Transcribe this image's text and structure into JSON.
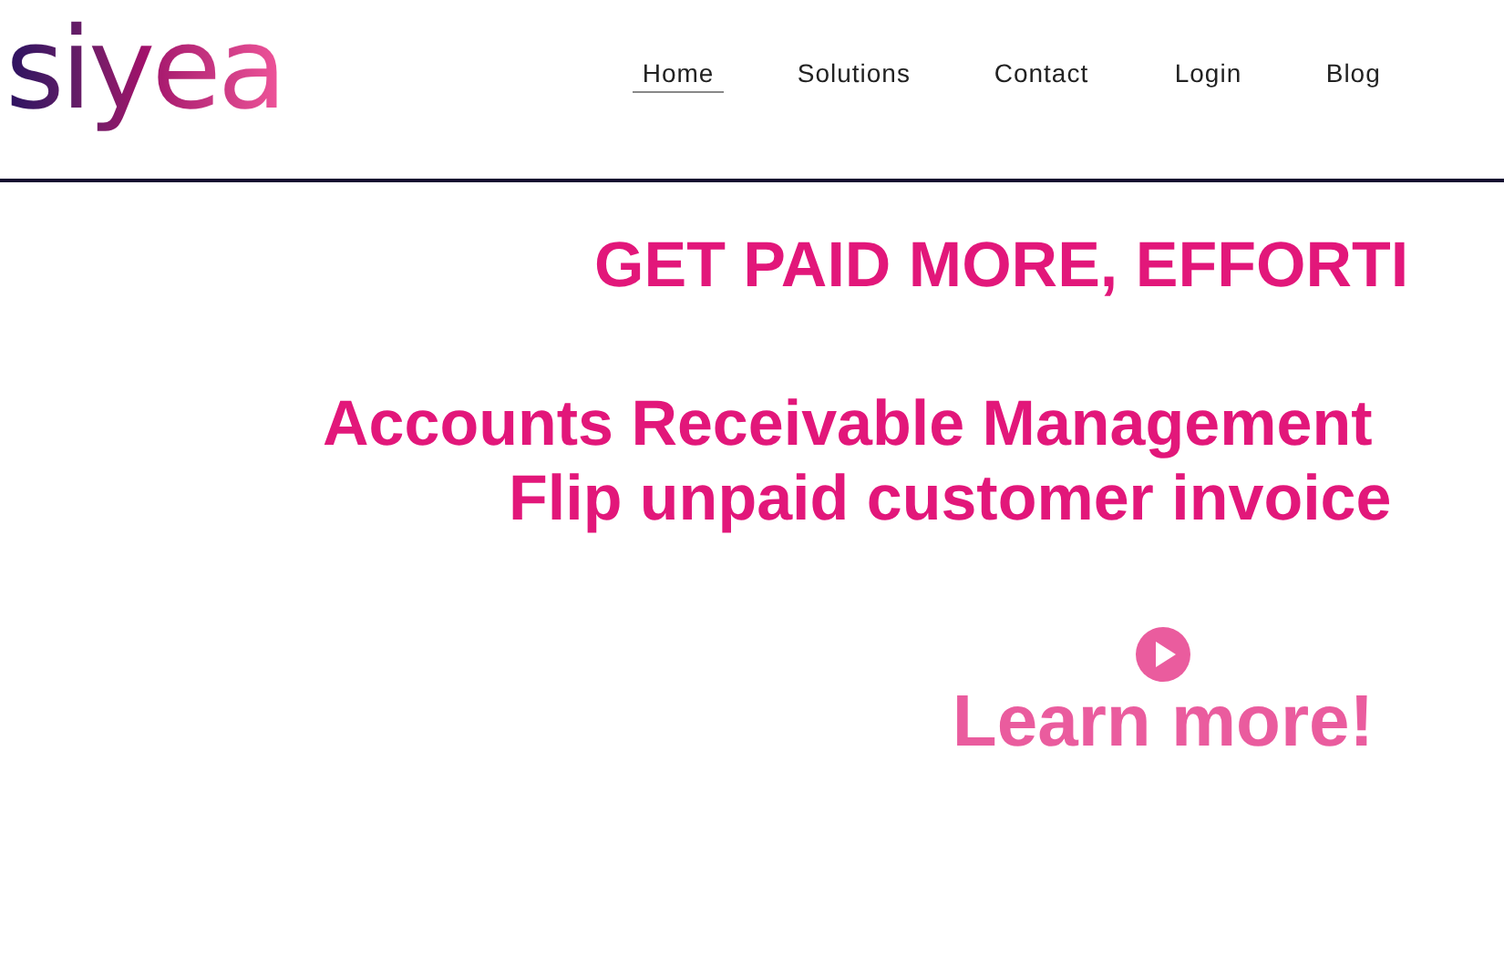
{
  "logo": "siyea",
  "nav": [
    {
      "label": "Home",
      "selected": true
    },
    {
      "label": "Solutions",
      "selected": false
    },
    {
      "label": "Contact",
      "selected": false
    },
    {
      "label": "Login",
      "selected": false
    },
    {
      "label": "Blog",
      "selected": false
    }
  ],
  "hero": {
    "headline": "GET PAID MORE, EFFORTI",
    "subheadline": [
      "Accounts Receivable Management",
      "Flip unpaid customer invoice"
    ],
    "cta": "Learn more!"
  }
}
